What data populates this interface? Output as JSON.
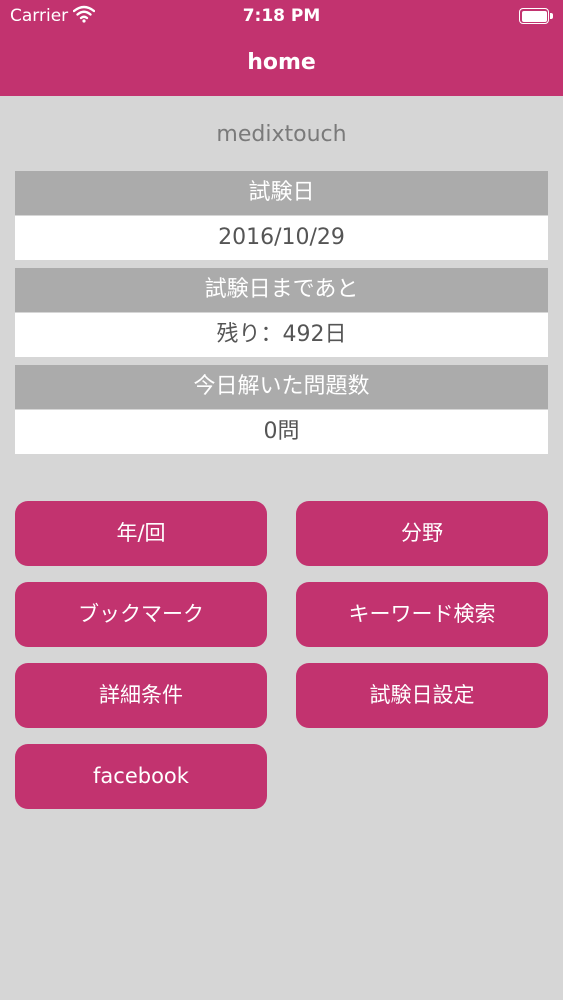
{
  "status_bar": {
    "carrier": "Carrier",
    "time": "7:18 PM"
  },
  "nav": {
    "title": "home"
  },
  "app_name": "medixtouch",
  "info": {
    "exam_date_label": "試験日",
    "exam_date_value": "2016/10/29",
    "remaining_label": "試験日まであと",
    "remaining_value": "残り：492日",
    "solved_today_label": "今日解いた問題数",
    "solved_today_value": "0問"
  },
  "buttons": {
    "year_round": "年/回",
    "field": "分野",
    "bookmark": "ブックマーク",
    "keyword_search": "キーワード検索",
    "detail_conditions": "詳細条件",
    "exam_date_settings": "試験日設定",
    "facebook": "facebook"
  },
  "colors": {
    "accent": "#c2336f",
    "background": "#d6d6d6",
    "info_header": "#ababab"
  }
}
